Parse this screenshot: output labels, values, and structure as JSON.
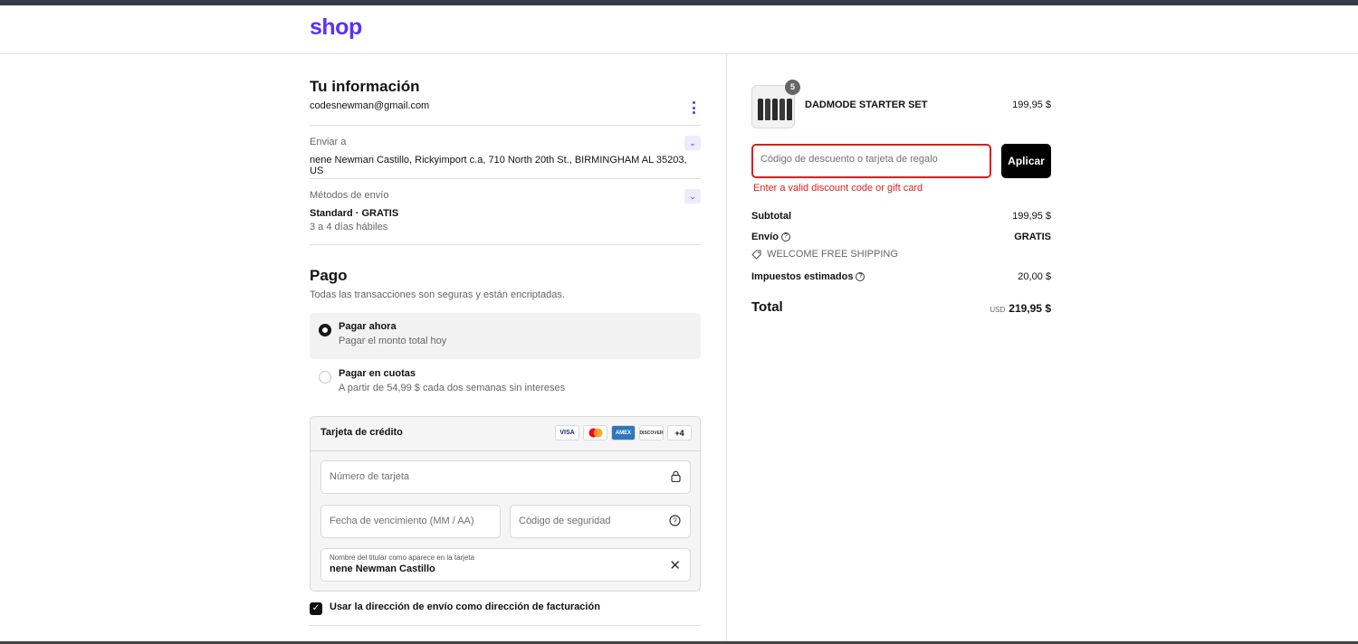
{
  "brand": {
    "logo": "shop",
    "color": "#5a31f4"
  },
  "info": {
    "title": "Tu información",
    "email": "codesnewman@gmail.com",
    "ship_to_label": "Enviar a",
    "ship_to_value": "nene Newman Castillo, Rickyimport c.a, 710 North 20th St., BIRMINGHAM AL 35203, US",
    "methods_label": "Métodos de envío",
    "method_value": "Standard · GRATIS",
    "method_time": "3 a 4 días hábiles"
  },
  "payment": {
    "title": "Pago",
    "subtitle": "Todas las transacciones son seguras y están encriptadas.",
    "options": [
      {
        "title": "Pagar ahora",
        "subtitle": "Pagar el monto total hoy",
        "selected": true
      },
      {
        "title": "Pagar en cuotas",
        "subtitle": "A partir de 54,99 $ cada dos semanas sin intereses",
        "selected": false
      }
    ],
    "card_title": "Tarjeta de crédito",
    "card_logos": [
      "VISA",
      "MC",
      "AMEX",
      "DISCOVER",
      "+4"
    ],
    "card_number_placeholder": "Número de tarjeta",
    "expiry_placeholder": "Fecha de vencimiento (MM / AA)",
    "cvv_placeholder": "Código de seguridad",
    "name_label": "Nombre del titular como aparece en la tarjeta",
    "name_value": "nene Newman Castillo",
    "billing_checkbox_label": "Usar la dirección de envío como dirección de facturación",
    "billing_checked": true
  },
  "summary": {
    "product_name": "DADMODE STARTER SET",
    "product_price": "199,95 $",
    "quantity": "5",
    "discount_placeholder": "Código de descuento o tarjeta de regalo",
    "apply_label": "Aplicar",
    "error": "Enter a valid discount code or gift card",
    "subtotal_label": "Subtotal",
    "subtotal_value": "199,95 $",
    "shipping_label": "Envío",
    "shipping_value": "GRATIS",
    "shipping_tag": "WELCOME FREE SHIPPING",
    "taxes_label": "Impuestos estimados",
    "taxes_value": "20,00 $",
    "total_label": "Total",
    "total_currency": "USD",
    "total_value": "219,95 $"
  },
  "colors": {
    "error": "#dd1d1d",
    "accent": "#5a31f4",
    "selected_bg": "#f2f2f3"
  }
}
